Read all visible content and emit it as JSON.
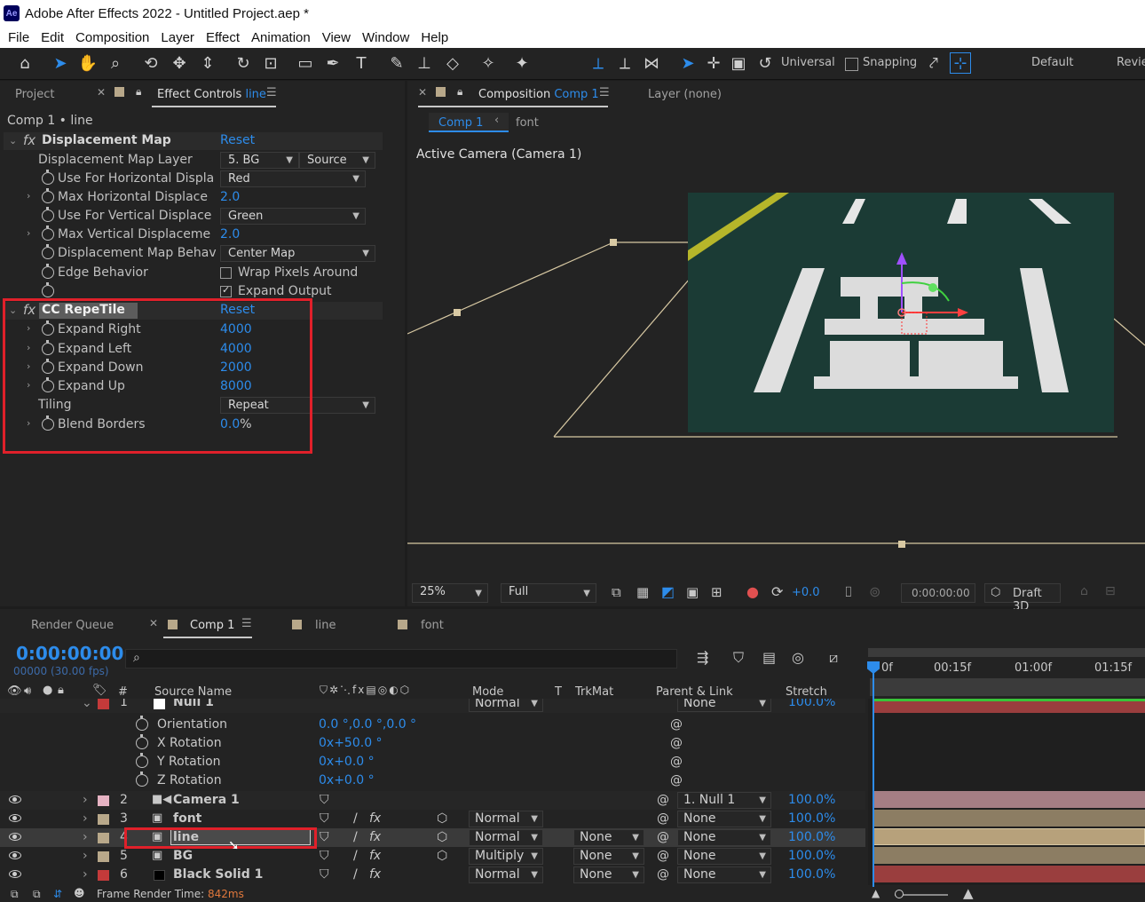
{
  "app": {
    "title": "Adobe After Effects 2022 - Untitled Project.aep *",
    "icon_label": "Ae",
    "menu": [
      "File",
      "Edit",
      "Composition",
      "Layer",
      "Effect",
      "Animation",
      "View",
      "Window",
      "Help"
    ]
  },
  "toolbar": {
    "universal_label": "Universal",
    "snapping_label": "Snapping",
    "workspace_default": "Default",
    "workspace_review": "Revie"
  },
  "left_panel": {
    "tab_project": "Project",
    "tab_effect_controls": "Effect Controls",
    "tab_effect_controls_layer": "line",
    "breadcrumb": "Comp 1 • line",
    "displacement_map": {
      "name": "Displacement Map",
      "reset": "Reset",
      "rows": [
        {
          "label": "Displacement Map Layer",
          "dd1": "5. BG",
          "dd2": "Source"
        },
        {
          "label": "Use For Horizontal Displa",
          "dd": "Red"
        },
        {
          "label": "Max Horizontal Displace",
          "value": "2.0"
        },
        {
          "label": "Use For Vertical Displace",
          "dd": "Green"
        },
        {
          "label": "Max Vertical Displaceme",
          "value": "2.0"
        },
        {
          "label": "Displacement Map Behav",
          "dd": "Center Map"
        },
        {
          "label": "Edge Behavior",
          "check": "Wrap Pixels Around"
        },
        {
          "label": "",
          "check": "Expand Output"
        }
      ]
    },
    "repetile": {
      "name": "CC RepeTile",
      "reset": "Reset",
      "rows": [
        {
          "label": "Expand Right",
          "value": "4000"
        },
        {
          "label": "Expand Left",
          "value": "4000"
        },
        {
          "label": "Expand Down",
          "value": "2000"
        },
        {
          "label": "Expand Up",
          "value": "8000"
        },
        {
          "label": "Tiling",
          "dd": "Repeat"
        },
        {
          "label": "Blend Borders",
          "value": "0.0",
          "unit": "%"
        }
      ]
    }
  },
  "comp_panel": {
    "tab_composition": "Composition",
    "tab_comp_name": "Comp 1",
    "tab_layer": "Layer (none)",
    "nav_comp": "Comp 1",
    "nav_font": "font",
    "camera_label": "Active Camera (Camera 1)",
    "zoom": "25%",
    "resolution": "Full",
    "exposure": "+0.0",
    "timecode": "0:00:00:00",
    "renderer": "Draft 3D"
  },
  "timeline": {
    "tab_render_queue": "Render Queue",
    "tab_comp1": "Comp 1",
    "tab_line": "line",
    "tab_font": "font",
    "current_time": "0:00:00:00",
    "frame_info": "00000 (30.00 fps)",
    "search_glyph": "⌕",
    "columns": {
      "num": "#",
      "source": "Source Name",
      "mode": "Mode",
      "t": "T",
      "trkmat": "TrkMat",
      "parent": "Parent & Link",
      "stretch": "Stretch"
    },
    "ruler": [
      "0f",
      "00:15f",
      "01:00f",
      "01:15f"
    ],
    "null_row": {
      "num": "1",
      "name": "Null 1",
      "mode": "Normal",
      "parent": "None",
      "stretch": "100.0%"
    },
    "props": [
      {
        "name": "Orientation",
        "value": "0.0 °,0.0 °,0.0 °"
      },
      {
        "name": "X Rotation",
        "value": "0x+50.0 °"
      },
      {
        "name": "Y Rotation",
        "value": "0x+0.0 °"
      },
      {
        "name": "Z Rotation",
        "value": "0x+0.0 °"
      }
    ],
    "layers": [
      {
        "num": "2",
        "name": "Camera 1",
        "mode": "",
        "trkmat": "",
        "parent": "1. Null 1",
        "stretch": "100.0%",
        "color": "#e6b3c3"
      },
      {
        "num": "3",
        "name": "font",
        "mode": "Normal",
        "trkmat": "",
        "parent": "None",
        "stretch": "100.0%",
        "color": "#b8a88a"
      },
      {
        "num": "4",
        "name": "line",
        "mode": "Normal",
        "trkmat": "None",
        "parent": "None",
        "stretch": "100.0%",
        "color": "#b8a88a"
      },
      {
        "num": "5",
        "name": "BG",
        "mode": "Multiply",
        "trkmat": "None",
        "parent": "None",
        "stretch": "100.0%",
        "color": "#b8a88a"
      },
      {
        "num": "6",
        "name": "Black Solid 1",
        "mode": "Normal",
        "trkmat": "None",
        "parent": "None",
        "stretch": "100.0%",
        "color": "#c43a3a"
      }
    ],
    "status_label": "Frame Render Time:",
    "status_value": "842ms"
  },
  "colors": {
    "accent": "#2d8ceb",
    "highlight_box": "#e0202a"
  }
}
